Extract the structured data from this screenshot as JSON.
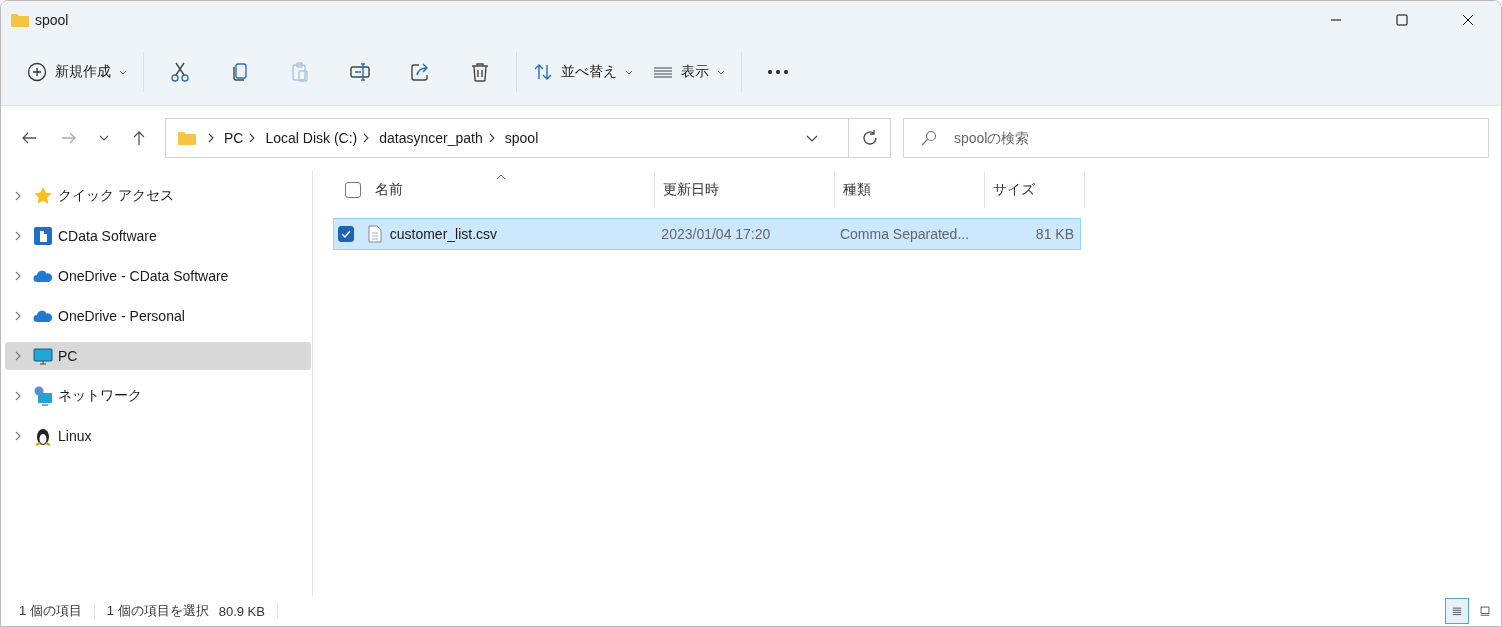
{
  "window": {
    "title": "spool"
  },
  "toolbar": {
    "new_label": "新規作成",
    "actions": [
      {
        "kind": "cut",
        "disabled": false
      },
      {
        "kind": "copy",
        "disabled": false
      },
      {
        "kind": "paste",
        "disabled": true
      },
      {
        "kind": "rename",
        "disabled": false
      },
      {
        "kind": "share",
        "disabled": false
      },
      {
        "kind": "delete",
        "disabled": false
      }
    ],
    "sort_label": "並べ替え",
    "view_label": "表示"
  },
  "address": {
    "segments": [
      "PC",
      "Local Disk (C:)",
      "datasyncer_path",
      "spool"
    ]
  },
  "search": {
    "placeholder": "spoolの検索"
  },
  "sidebar": {
    "items": [
      {
        "label": "クイック アクセス",
        "kind": "star",
        "selected": false
      },
      {
        "label": "CData Software",
        "kind": "building",
        "selected": false
      },
      {
        "label": "OneDrive - CData Software",
        "kind": "cloud",
        "selected": false
      },
      {
        "label": "OneDrive - Personal",
        "kind": "cloud",
        "selected": false
      },
      {
        "label": "PC",
        "kind": "monitor",
        "selected": true
      },
      {
        "label": "ネットワーク",
        "kind": "network",
        "selected": false
      },
      {
        "label": "Linux",
        "kind": "penguin",
        "selected": false
      }
    ]
  },
  "table": {
    "all_checked": false,
    "columns": [
      {
        "label": "名前",
        "sorted": true
      },
      {
        "label": "更新日時",
        "sorted": false
      },
      {
        "label": "種類",
        "sorted": false
      },
      {
        "label": "サイズ",
        "sorted": false
      }
    ],
    "rows": [
      {
        "name": "customer_list.csv",
        "date": "2023/01/04 17:20",
        "type": "Comma Separated...",
        "size": "81 KB",
        "selected": true,
        "checked": true
      }
    ]
  },
  "status_bar": {
    "count": "1 個の項目",
    "selection": "1 個の項目を選択",
    "size": "80.9 KB",
    "views": [
      {
        "kind": "details",
        "selected": true
      },
      {
        "kind": "tiles",
        "selected": false
      }
    ]
  }
}
